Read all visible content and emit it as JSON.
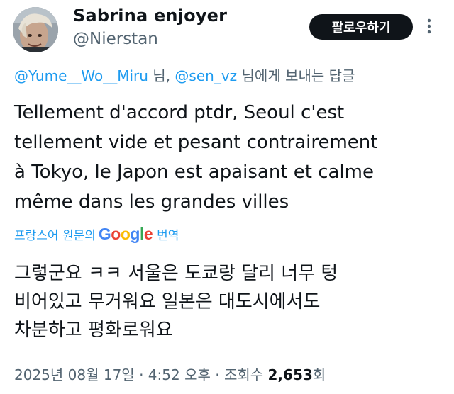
{
  "author": {
    "display_name": "Sabrina enjoyer",
    "handle": "@Nierstan",
    "avatar_icon": "profile-photo"
  },
  "header": {
    "follow_label": "팔로우하기",
    "more_icon": "more-vertical-icon"
  },
  "reply_context": {
    "mention_1": "@Yume__Wo__Miru",
    "sep_1": " 님, ",
    "mention_2": "@sen_vz",
    "suffix": " 님에게 보내는 답글"
  },
  "tweet": {
    "text": "Tellement d'accord ptdr, Seoul c'est\ntellement vide et pesant contrairement\nà Tokyo, le Japon est apaisant et calme\nmême dans les grandes villes"
  },
  "translation": {
    "label_prefix": "프랑스어 원문의",
    "google_letters": [
      "G",
      "o",
      "o",
      "g",
      "l",
      "e"
    ],
    "label_suffix": "번역",
    "text": "그렇군요 ㅋㅋ 서울은 도쿄랑 달리 너무 텅\n비어있고 무거워요 일본은 대도시에서도\n차분하고 평화로워요"
  },
  "meta": {
    "date": "2025년 08월 17일",
    "sep_1": " · ",
    "time": "4:52 오후",
    "sep_2": " · ",
    "views_label": "조회수 ",
    "views_count": "2,653",
    "views_unit": "회"
  },
  "colors": {
    "accent": "#1d9bf0",
    "text": "#0f1419",
    "secondary": "#536471",
    "button_bg": "#0f1419"
  }
}
